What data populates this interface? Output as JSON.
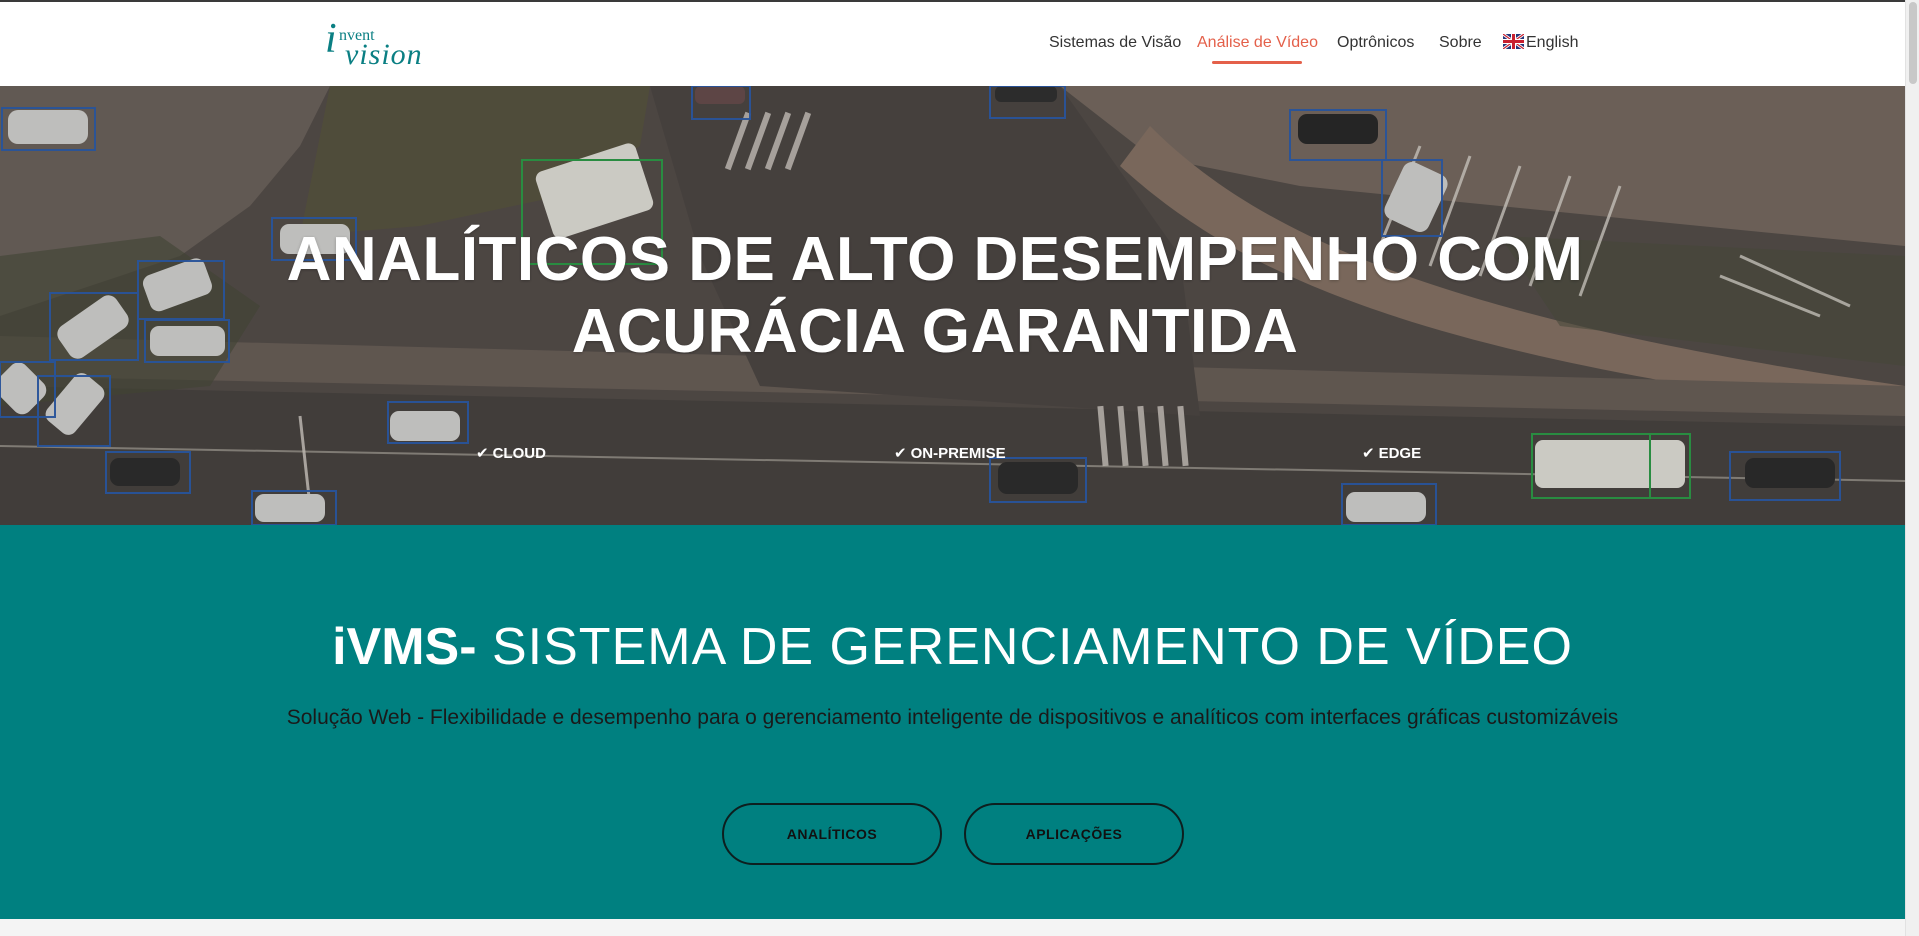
{
  "header": {
    "logo_i": "i",
    "logo_invent": "nvent",
    "logo_vision": "vision",
    "nav": [
      {
        "label": "Sistemas de Visão",
        "active": false
      },
      {
        "label": "Análise de Vídeo",
        "active": true
      },
      {
        "label": "Optrônicos",
        "active": false
      },
      {
        "label": "Sobre",
        "active": false
      },
      {
        "label": "English",
        "icon": "uk-flag-icon",
        "active": false
      }
    ]
  },
  "hero": {
    "title_line1": "ANALÍTICOS DE ALTO DESEMPENHO COM",
    "title_line2": "ACURÁCIA GARANTIDA",
    "features": [
      "CLOUD",
      "ON-PREMISE",
      "EDGE"
    ],
    "check_icon": "check-icon"
  },
  "ivms": {
    "brand": "iVMS-",
    "title": " SISTEMA DE GERENCIAMENTO DE VÍDEO",
    "subtitle": "Solução Web - Flexibilidade e desempenho para o gerenciamento inteligente de dispositivos e analíticos com interfaces gráficas customizáveis",
    "buttons": [
      "ANALÍTICOS",
      "APLICAÇÕES"
    ]
  },
  "colors": {
    "brand_teal": "#008080",
    "logo_teal": "#0a7f83",
    "active_nav": "#e4604a"
  }
}
